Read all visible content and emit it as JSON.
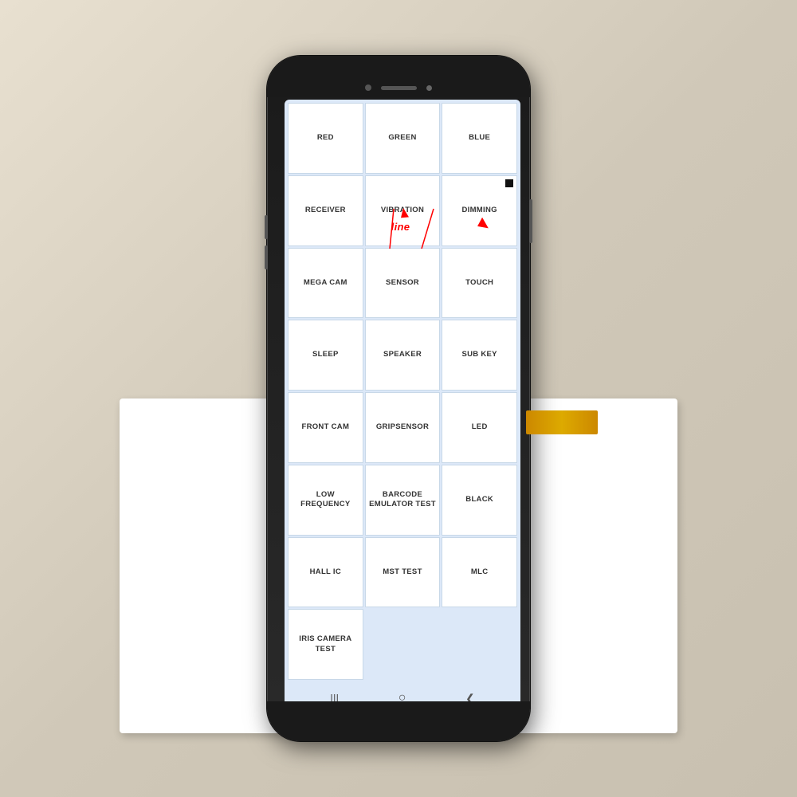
{
  "phone": {
    "screen_bg": "#dce8f8"
  },
  "grid": {
    "cells": [
      {
        "id": "red",
        "label": "RED",
        "row": 1,
        "col": 1
      },
      {
        "id": "green",
        "label": "GREEN",
        "row": 1,
        "col": 2
      },
      {
        "id": "blue",
        "label": "BLUE",
        "row": 1,
        "col": 3
      },
      {
        "id": "receiver",
        "label": "RECEIVER",
        "row": 2,
        "col": 1
      },
      {
        "id": "vibration",
        "label": "VIBRATION",
        "row": 2,
        "col": 2
      },
      {
        "id": "dimming",
        "label": "DIMMING",
        "row": 2,
        "col": 3
      },
      {
        "id": "mega-cam",
        "label": "MEGA CAM",
        "row": 3,
        "col": 1
      },
      {
        "id": "sensor",
        "label": "SENSOR",
        "row": 3,
        "col": 2
      },
      {
        "id": "touch",
        "label": "TOUCH",
        "row": 3,
        "col": 3
      },
      {
        "id": "sleep",
        "label": "SLEEP",
        "row": 4,
        "col": 1
      },
      {
        "id": "speaker",
        "label": "SPEAKER",
        "row": 4,
        "col": 2
      },
      {
        "id": "sub-key",
        "label": "SUB KEY",
        "row": 4,
        "col": 3
      },
      {
        "id": "front-cam",
        "label": "FRONT CAM",
        "row": 5,
        "col": 1
      },
      {
        "id": "gripsensor",
        "label": "GRIPSENSOR",
        "row": 5,
        "col": 2
      },
      {
        "id": "led",
        "label": "LED",
        "row": 5,
        "col": 3
      },
      {
        "id": "low-frequency",
        "label": "LOW FREQUENCY",
        "row": 6,
        "col": 1
      },
      {
        "id": "barcode-emulator",
        "label": "BARCODE\nEMULATOR TEST",
        "row": 6,
        "col": 2
      },
      {
        "id": "black",
        "label": "BLACK",
        "row": 6,
        "col": 3
      },
      {
        "id": "hall-ic",
        "label": "HALL IC",
        "row": 7,
        "col": 1
      },
      {
        "id": "mst-test",
        "label": "MST TEST",
        "row": 7,
        "col": 2
      },
      {
        "id": "mlc",
        "label": "MLC",
        "row": 7,
        "col": 3
      },
      {
        "id": "iris-camera",
        "label": "IRIS CAMERA\nTEST",
        "row": 8,
        "col": 1
      }
    ]
  },
  "nav": {
    "back": "❮",
    "home": "○",
    "recents": "|||"
  },
  "annotation": {
    "line_label": "line"
  }
}
